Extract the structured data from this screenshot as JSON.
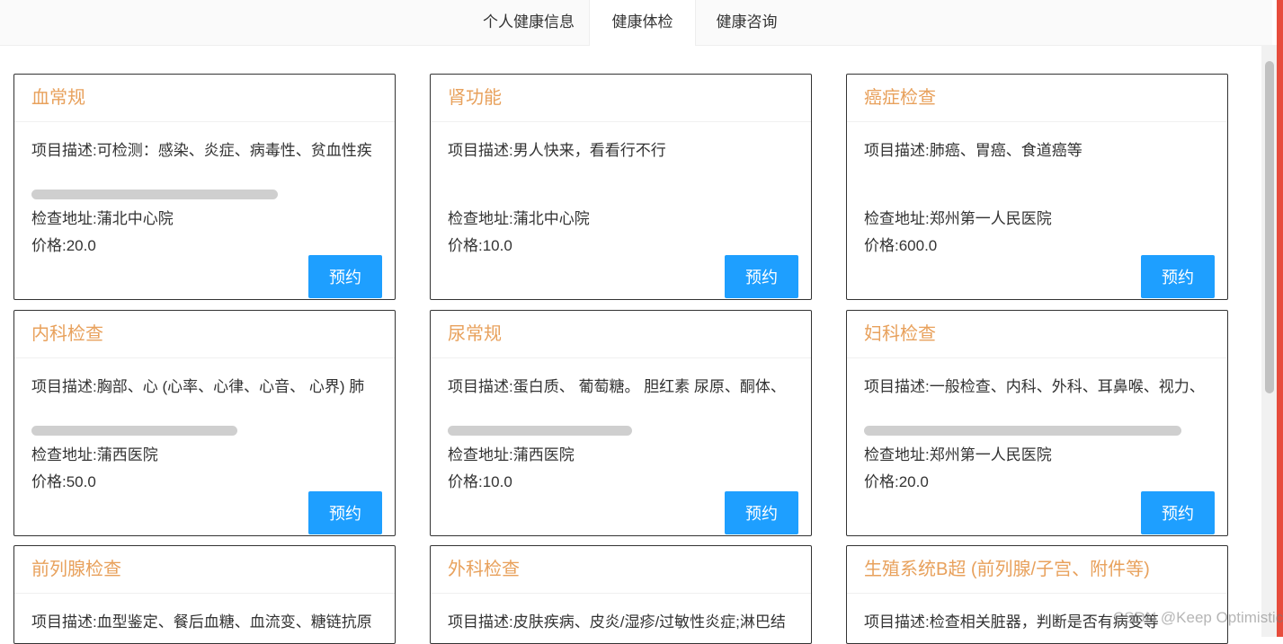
{
  "nav": {
    "tabs": [
      {
        "label": "个人健康信息"
      },
      {
        "label": "健康体检"
      },
      {
        "label": "健康咨询"
      }
    ],
    "active_index": 1
  },
  "colors": {
    "accent": "#1e9fff",
    "title": "#e8a15c",
    "edge": "#e74c3c"
  },
  "book_label": "预约",
  "cards": [
    {
      "title": "血常规",
      "desc": "项目描述:可检测：感染、炎症、病毒性、贫血性疾",
      "address": "检查地址:蒲北中心院",
      "price": "价格:20.0"
    },
    {
      "title": "肾功能",
      "desc": "项目描述:男人快来，看看行不行",
      "address": "检查地址:蒲北中心院",
      "price": "价格:10.0"
    },
    {
      "title": "癌症检查",
      "desc": "项目描述:肺癌、胃癌、食道癌等",
      "address": "检查地址:郑州第一人民医院",
      "price": "价格:600.0"
    },
    {
      "title": "内科检查",
      "desc": "项目描述:胸部、心 (心率、心律、心音、 心界) 肺",
      "address": "检查地址:蒲西医院",
      "price": "价格:50.0"
    },
    {
      "title": "尿常规",
      "desc": "项目描述:蛋白质、 葡萄糖。 胆红素 尿原、酮体、",
      "address": "检查地址:蒲西医院",
      "price": "价格:10.0"
    },
    {
      "title": "妇科检查",
      "desc": "项目描述:一般检查、内科、外科、耳鼻喉、视力、",
      "address": "检查地址:郑州第一人民医院",
      "price": "价格:20.0"
    },
    {
      "title": "前列腺检查",
      "desc": "项目描述:血型鉴定、餐后血糖、血流变、糖链抗原",
      "address": "",
      "price": ""
    },
    {
      "title": "外科检查",
      "desc": "项目描述:皮肤疾病、皮炎/湿疹/过敏性炎症;淋巴结",
      "address": "",
      "price": ""
    },
    {
      "title": "生殖系统B超 (前列腺/子宫、附件等)",
      "desc": "项目描述:检查相关脏器，判断是否有病变等",
      "address": "",
      "price": ""
    }
  ],
  "watermark": "CSDN @Keep Optimistic"
}
